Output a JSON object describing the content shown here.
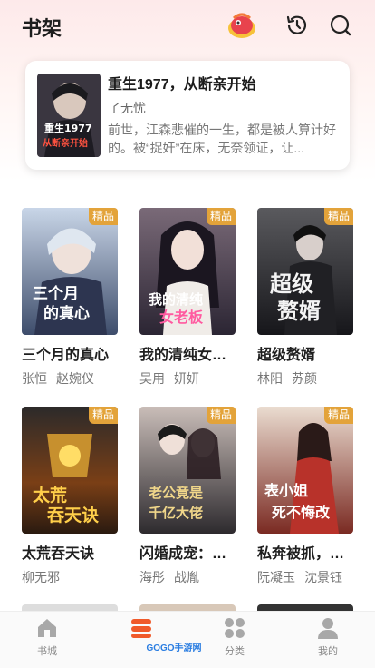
{
  "header": {
    "title": "书架"
  },
  "recent": {
    "title": "重生1977，从断亲开始",
    "author": "了无忧",
    "description": "前世，江森悲催的一生，都是被人算计好的。被“捉奸”在床，无奈领证，让...",
    "cover_text": "重生1977 从断亲开始"
  },
  "badge_label": "精品",
  "books": [
    {
      "title": "三个月的真心",
      "authors": [
        "张恒",
        "赵婉仪"
      ],
      "cover_text": "三个月的真心"
    },
    {
      "title": "我的清纯女老板",
      "authors": [
        "吴用",
        "妍妍"
      ],
      "cover_text": "我的清纯女老板"
    },
    {
      "title": "超级赘婿",
      "authors": [
        "林阳",
        "苏颜"
      ],
      "cover_text": "超级赘婿"
    },
    {
      "title": "太荒吞天诀",
      "authors": [
        "柳无邪"
      ],
      "cover_text": "太荒吞天诀"
    },
    {
      "title": "闪婚成宠：老公竟是千亿大佬",
      "authors": [
        "海彤",
        "战胤"
      ],
      "cover_text": "老公竟是千亿大佬"
    },
    {
      "title": "私奔被抓，表小姐死不悔改",
      "authors": [
        "阮凝玉",
        "沈景钰"
      ],
      "cover_text": "表小姐死不悔改"
    }
  ],
  "tabs": [
    {
      "label": "书城",
      "icon": "home-icon"
    },
    {
      "label": "",
      "icon": "bookshelf-icon",
      "active": true
    },
    {
      "label": "分类",
      "icon": "category-grid-icon"
    },
    {
      "label": "我的",
      "icon": "profile-icon"
    }
  ],
  "watermark": "GOGO手游网",
  "colors": {
    "accent": "#f05a2a",
    "badge": "#e3a33a"
  }
}
